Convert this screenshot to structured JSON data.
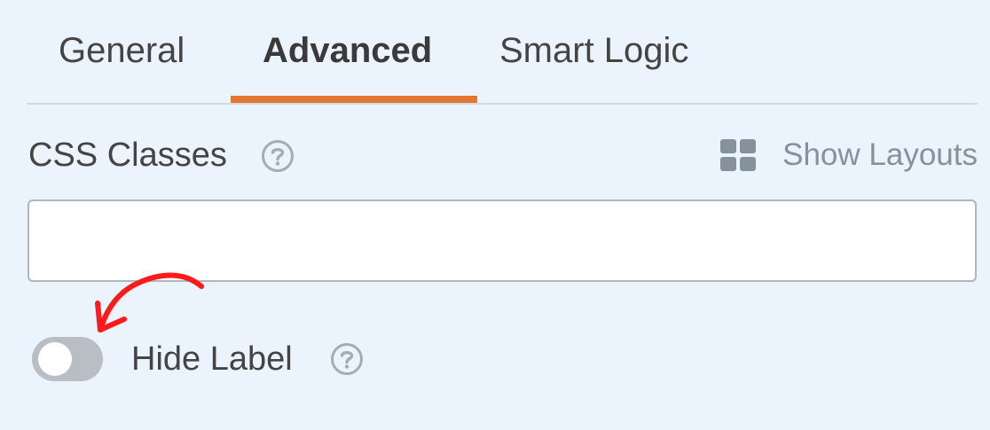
{
  "tabs": [
    {
      "label": "General",
      "active": false
    },
    {
      "label": "Advanced",
      "active": true
    },
    {
      "label": "Smart Logic",
      "active": false
    }
  ],
  "css_classes": {
    "label": "CSS Classes",
    "help_icon": "question-circle-icon",
    "value": "",
    "placeholder": ""
  },
  "show_layouts": {
    "label": "Show Layouts",
    "icon": "grid-layout-icon"
  },
  "hide_label": {
    "label": "Hide Label",
    "enabled": false,
    "help_icon": "question-circle-icon"
  },
  "colors": {
    "background": "#ebf3fc",
    "accent": "#e27730",
    "annotation_arrow": "#ff1a1a",
    "toggle_off": "#b9bec4",
    "muted_text": "#86919e"
  }
}
